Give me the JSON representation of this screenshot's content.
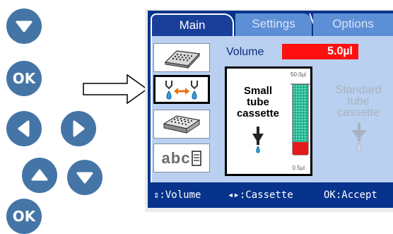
{
  "nav_buttons": {
    "down_icon": "chevron-down-icon",
    "ok_label": "OK",
    "left_icon": "chevron-left-icon",
    "right_icon": "chevron-right-icon",
    "up_icon": "chevron-up-icon",
    "down2_icon": "chevron-down-icon",
    "ok2_label": "OK"
  },
  "colors": {
    "button_blue": "#4575a6",
    "screen_blue": "#08338c",
    "panel_light_blue": "#b9d0f0",
    "volume_field_red": "#ff1010"
  },
  "tabs": [
    {
      "label": "Main",
      "active": true
    },
    {
      "label": "Settings",
      "active": false
    },
    {
      "label": "Options",
      "active": false
    }
  ],
  "sidebar": {
    "items": [
      {
        "icon": "plate-tilted-icon",
        "selected": false
      },
      {
        "icon": "pipette-transfer-icon",
        "selected": true
      },
      {
        "icon": "well-plate-icon",
        "selected": false
      },
      {
        "label": "abc",
        "icon": "document-icon",
        "selected": false
      }
    ]
  },
  "volume": {
    "label": "Volume",
    "value": "5.0µl"
  },
  "cassettes": {
    "small": {
      "name_line1": "Small",
      "name_line2": "tube",
      "name_line3": "cassette",
      "scale_max": "50.0µl",
      "scale_min": "0.5µl",
      "selected": true
    },
    "standard": {
      "name_line1": "Standard",
      "name_line2": "tube",
      "name_line3": "cassette",
      "selected": false
    }
  },
  "hints": {
    "volume": "⇕:Volume",
    "cassette": "◂▸:Cassette",
    "accept": "OK:Accept"
  }
}
